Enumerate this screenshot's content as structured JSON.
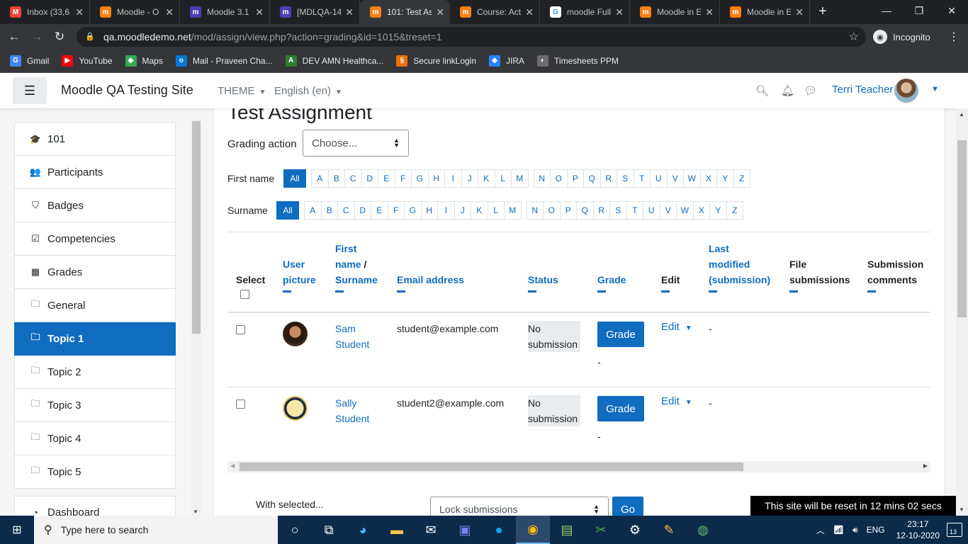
{
  "browser": {
    "tabs": [
      {
        "title": "Inbox (33,6",
        "favicon": "gmail-icon",
        "color": "#ea4335",
        "glyph": "M"
      },
      {
        "title": "Moodle - O",
        "favicon": "moodle-icon",
        "color": "#f98012",
        "glyph": "m"
      },
      {
        "title": "Moodle 3.1",
        "favicon": "moodle-tracker-icon",
        "color": "#4a3fb5",
        "glyph": "m"
      },
      {
        "title": "[MDLQA-14",
        "favicon": "moodle-tracker-icon",
        "color": "#4a3fb5",
        "glyph": "m"
      },
      {
        "title": "101: Test As",
        "favicon": "moodle-icon",
        "color": "#f98012",
        "glyph": "m",
        "active": true
      },
      {
        "title": "Course: Act",
        "favicon": "moodle-icon",
        "color": "#f98012",
        "glyph": "m"
      },
      {
        "title": "moodle Full",
        "favicon": "google-icon",
        "color": "#ffffff",
        "glyph": "G"
      },
      {
        "title": "Moodle in E",
        "favicon": "moodle-icon",
        "color": "#f98012",
        "glyph": "m"
      },
      {
        "title": "Moodle in E",
        "favicon": "moodle-icon",
        "color": "#f98012",
        "glyph": "m"
      }
    ],
    "url_host": "qa.moodledemo.net",
    "url_path": "/mod/assign/view.php?action=grading&id=1015&treset=1",
    "incognito_label": "Incognito",
    "bookmarks": [
      {
        "label": "Gmail",
        "icon": "google-icon",
        "color": "#4285f4",
        "glyph": "G"
      },
      {
        "label": "YouTube",
        "icon": "youtube-icon",
        "color": "#ff0000",
        "glyph": "▶"
      },
      {
        "label": "Maps",
        "icon": "maps-icon",
        "color": "#34a853",
        "glyph": "◆"
      },
      {
        "label": "Mail - Praveen Cha...",
        "icon": "outlook-icon",
        "color": "#0078d4",
        "glyph": "o"
      },
      {
        "label": "DEV AMN Healthca...",
        "icon": "amn-icon",
        "color": "#2e7d32",
        "glyph": "A"
      },
      {
        "label": "Secure linkLogin",
        "icon": "link-icon",
        "color": "#e8710a",
        "glyph": "§"
      },
      {
        "label": "JIRA",
        "icon": "jira-icon",
        "color": "#2684ff",
        "glyph": "◆"
      },
      {
        "label": "Timesheets PPM",
        "icon": "timesheet-icon",
        "color": "#6c6c6c",
        "glyph": "◐"
      }
    ]
  },
  "header": {
    "site_name": "Moodle QA Testing Site",
    "theme_label": "THEME",
    "language_label": "English (en)",
    "user_name": "Terri Teacher"
  },
  "drawer": {
    "items": [
      {
        "label": "101",
        "icon": "graduation-cap-icon",
        "glyph": "🎓"
      },
      {
        "label": "Participants",
        "icon": "users-icon",
        "glyph": "👥"
      },
      {
        "label": "Badges",
        "icon": "shield-icon",
        "glyph": "⛉"
      },
      {
        "label": "Competencies",
        "icon": "checkbox-icon",
        "glyph": "☑"
      },
      {
        "label": "Grades",
        "icon": "table-icon",
        "glyph": "▦"
      },
      {
        "label": "General",
        "icon": "folder-icon",
        "glyph": "🗀"
      },
      {
        "label": "Topic 1",
        "icon": "folder-icon",
        "glyph": "🗀",
        "active": true
      },
      {
        "label": "Topic 2",
        "icon": "folder-icon",
        "glyph": "🗀"
      },
      {
        "label": "Topic 3",
        "icon": "folder-icon",
        "glyph": "🗀"
      },
      {
        "label": "Topic 4",
        "icon": "folder-icon",
        "glyph": "🗀"
      },
      {
        "label": "Topic 5",
        "icon": "folder-icon",
        "glyph": "🗀"
      }
    ],
    "dashboard_label": "Dashboard"
  },
  "main": {
    "title": "Test Assignment",
    "grading_action_label": "Grading action",
    "grading_action_value": "Choose...",
    "first_name_label": "First name",
    "surname_label": "Surname",
    "initials_all": "All",
    "initials_group1": [
      "A",
      "B",
      "C",
      "D",
      "E",
      "F",
      "G",
      "H",
      "I",
      "J",
      "K",
      "L",
      "M"
    ],
    "initials_group2": [
      "N",
      "O",
      "P",
      "Q",
      "R",
      "S",
      "T",
      "U",
      "V",
      "W",
      "X",
      "Y",
      "Z"
    ],
    "columns": {
      "select": "Select",
      "user_picture_1": "User",
      "user_picture_2": "picture",
      "name_1": "First",
      "name_2": "name",
      "name_sep": " /",
      "name_3": "Surname",
      "email": "Email address",
      "status": "Status",
      "grade": "Grade",
      "edit": "Edit",
      "modified_1": "Last",
      "modified_2": "modified",
      "modified_3": "(submission)",
      "files_1": "File",
      "files_2": "submissions",
      "comments_1": "Submission",
      "comments_2": "comments"
    },
    "rows": [
      {
        "first": "Sam",
        "last": "Student",
        "email": "student@example.com",
        "status_1": "No",
        "status_2": "submission",
        "grade_button": "Grade",
        "grade_value": "-",
        "edit": "Edit",
        "modified": "-"
      },
      {
        "first": "Sally",
        "last": "Student",
        "email": "student2@example.com",
        "status_1": "No",
        "status_2": "submission",
        "grade_button": "Grade",
        "grade_value": "-",
        "edit": "Edit",
        "modified": "-"
      }
    ],
    "with_selected_label": "With selected...",
    "bulk_action_value": "Lock submissions",
    "go_label": "Go"
  },
  "reset_notice": "This site will be reset in 12 mins 02 secs",
  "taskbar": {
    "search_placeholder": "Type here to search",
    "language": "ENG",
    "time": "23:17",
    "date": "12-10-2020",
    "notification_count": "13"
  }
}
